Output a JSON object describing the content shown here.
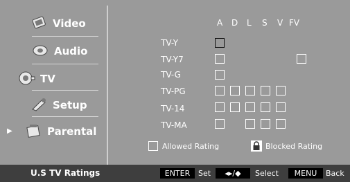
{
  "menu": {
    "items": [
      {
        "label": "Video",
        "icon": "video-icon"
      },
      {
        "label": "Audio",
        "icon": "audio-icon"
      },
      {
        "label": "TV",
        "icon": "tv-icon"
      },
      {
        "label": "Setup",
        "icon": "setup-icon"
      },
      {
        "label": "Parental",
        "icon": "parental-icon",
        "selected": true
      }
    ]
  },
  "ratings": {
    "columns": [
      "A",
      "D",
      "L",
      "S",
      "V",
      "FV"
    ],
    "rows": [
      {
        "label": "TV-Y"
      },
      {
        "label": "TV-Y7"
      },
      {
        "label": "TV-G"
      },
      {
        "label": "TV-PG"
      },
      {
        "label": "TV-14"
      },
      {
        "label": "TV-MA"
      }
    ]
  },
  "legend": {
    "allowed": "Allowed Rating",
    "blocked": "Blocked Rating"
  },
  "footer": {
    "title": "U.S TV Ratings",
    "enter_key": "ENTER",
    "enter_action": "Set",
    "select_action": "Select",
    "menu_key": "MENU",
    "menu_action": "Back"
  },
  "colors": {
    "background": "#9a9a9a",
    "footer": "#3e3e3e",
    "text": "#ffffff"
  }
}
